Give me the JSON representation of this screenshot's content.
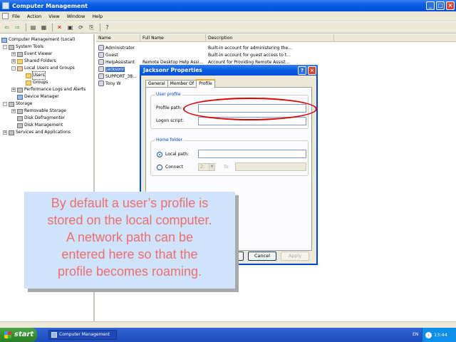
{
  "window": {
    "title": "Computer Management",
    "buttons": {
      "minimize": "_",
      "maximize": "□",
      "close": "×"
    }
  },
  "menu": [
    "File",
    "Action",
    "View",
    "Window",
    "Help"
  ],
  "toolbar": {
    "icons": [
      "back-arrow-icon",
      "forward-arrow-icon",
      "up-folder-icon",
      "show-hide-tree-icon",
      "delete-icon",
      "properties-icon",
      "refresh-icon",
      "export-list-icon",
      "help-icon"
    ]
  },
  "tree": {
    "items": [
      {
        "label": "Computer Management (Local)"
      },
      {
        "label": "System Tools"
      },
      {
        "label": "Event Viewer"
      },
      {
        "label": "Shared Folders"
      },
      {
        "label": "Local Users and Groups"
      },
      {
        "label": "Users"
      },
      {
        "label": "Groups"
      },
      {
        "label": "Performance Logs and Alerts"
      },
      {
        "label": "Device Manager"
      },
      {
        "label": "Storage"
      },
      {
        "label": "Removable Storage"
      },
      {
        "label": "Disk Defragmenter"
      },
      {
        "label": "Disk Management"
      },
      {
        "label": "Services and Applications"
      }
    ]
  },
  "list": {
    "columns": [
      "Name",
      "Full Name",
      "Description"
    ],
    "rows": [
      {
        "name": "Administrator",
        "full_name": "",
        "description": "Built-in account for administering the..."
      },
      {
        "name": "Guest",
        "full_name": "",
        "description": "Built-in account for guest access to t..."
      },
      {
        "name": "HelpAssistant",
        "full_name": "Remote Desktop Help Assi...",
        "description": "Account for Providing Remote Assist..."
      },
      {
        "name": "jacksonr",
        "full_name": "",
        "description": ""
      },
      {
        "name": "SUPPORT_38...",
        "full_name": "",
        "description": ""
      },
      {
        "name": "Tony W",
        "full_name": "",
        "description": ""
      }
    ]
  },
  "dialog": {
    "title": "Jacksonr Properties",
    "help_button": "?",
    "close_button": "×",
    "tabs": [
      "General",
      "Member Of",
      "Profile"
    ],
    "active_tab": "Profile",
    "user_profile": {
      "legend": "User profile",
      "profile_path_label": "Profile path:",
      "profile_path_value": "",
      "logon_script_label": "Logon script:",
      "logon_script_value": ""
    },
    "home_folder": {
      "legend": "Home folder",
      "local_path_label": "Local path:",
      "local_path_value": "",
      "connect_label": "Connect",
      "drive_value": "Z:",
      "to_label": "To:",
      "selected": "Local path"
    },
    "buttons": {
      "ok": "OK",
      "cancel": "Cancel",
      "apply": "Apply"
    }
  },
  "callout": {
    "lines": [
      "By default a user’s profile is",
      "stored on the local computer.",
      "A network path can be",
      "entered here so that the",
      "profile becomes roaming."
    ],
    "text_color": "#ef6d6d",
    "background": "#cfe3fb"
  },
  "highlight": {
    "color": "#e00000"
  },
  "taskbar": {
    "start_label": "start",
    "task_label": "Computer Management",
    "language": "EN",
    "clock": "13:44"
  }
}
